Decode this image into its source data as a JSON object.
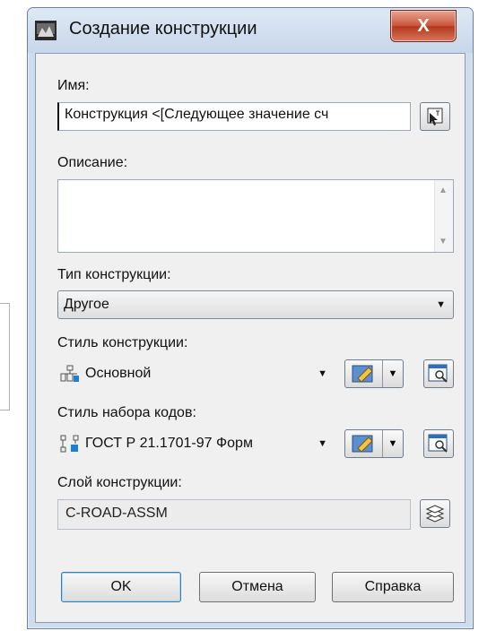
{
  "window": {
    "title": "Создание конструкции",
    "close_glyph": "X"
  },
  "fields": {
    "name_label": "Имя:",
    "name_value": "Конструкция <[Следующее значение сч",
    "description_label": "Описание:",
    "description_value": "",
    "type_label": "Тип конструкции:",
    "type_value": "Другое",
    "style_label": "Стиль конструкции:",
    "style_value": "Основной",
    "codeset_label": "Стиль набора кодов:",
    "codeset_value": "ГОСТ Р 21.1701-97 Форм",
    "layer_label": "Слой конструкции:",
    "layer_value": "C-ROAD-ASSM"
  },
  "buttons": {
    "ok": "OK",
    "cancel": "Отмена",
    "help": "Справка"
  },
  "icons": {
    "app": "app-icon",
    "name_edit": "name-edit-icon",
    "style": "assembly-style-icon",
    "codeset": "code-set-icon",
    "edit": "edit-style-icon",
    "preview": "preview-icon",
    "layers": "layers-icon"
  },
  "colors": {
    "close": "#c9543a",
    "frame": "#cfdcec",
    "accent": "#3c7fb1"
  }
}
